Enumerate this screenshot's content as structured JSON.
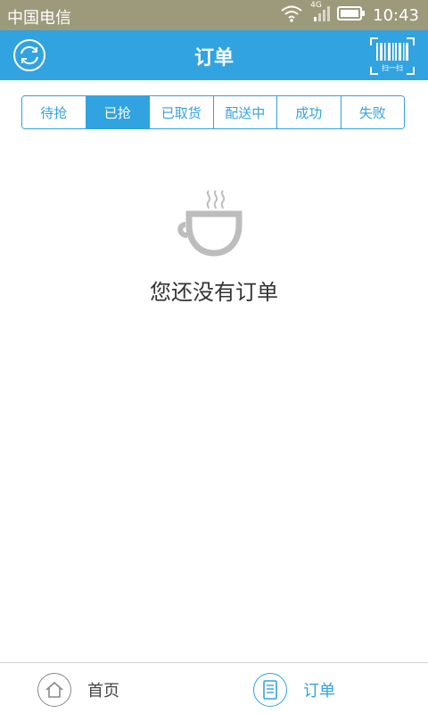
{
  "status_bar": {
    "carrier": "中国电信",
    "network": "4G",
    "time": "10:43"
  },
  "header": {
    "title": "订单",
    "scan_label": "扫一扫"
  },
  "tabs": [
    {
      "label": "待抢",
      "active": false
    },
    {
      "label": "已抢",
      "active": true
    },
    {
      "label": "已取货",
      "active": false
    },
    {
      "label": "配送中",
      "active": false
    },
    {
      "label": "成功",
      "active": false
    },
    {
      "label": "失败",
      "active": false
    }
  ],
  "empty_state": {
    "icon": "coffee-cup-icon",
    "message": "您还没有订单"
  },
  "bottom_nav": [
    {
      "label": "首页",
      "icon": "home-icon",
      "active": false
    },
    {
      "label": "订单",
      "icon": "document-icon",
      "active": true
    }
  ],
  "colors": {
    "accent": "#31a3e0",
    "status_bar": "#9c9a7a"
  }
}
